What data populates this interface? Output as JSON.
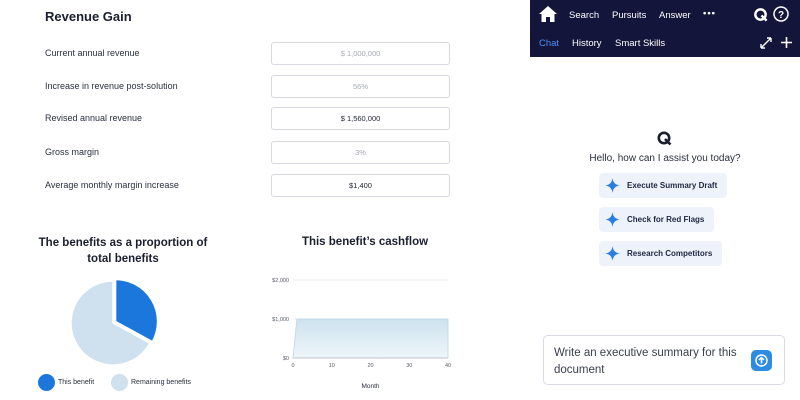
{
  "form": {
    "title": "Revenue Gain",
    "rows": [
      {
        "label": "Current annual revenue",
        "value": "$ 1,000,000",
        "placeholder": true
      },
      {
        "label": "Increase in revenue post-solution",
        "value": "56%",
        "placeholder": true
      },
      {
        "label": "Revised annual revenue",
        "value": "$ 1,560,000",
        "placeholder": false
      },
      {
        "label": "Gross margin",
        "value": "3%",
        "placeholder": true
      },
      {
        "label": "Average monthly margin increase",
        "value": "$1,400",
        "placeholder": false
      }
    ]
  },
  "pie": {
    "title_line1": "The benefits as a proportion of",
    "title_line2": "total benefits",
    "legend": [
      {
        "label": "This benefit",
        "color": "#1b77dc"
      },
      {
        "label": "Remaining benefits",
        "color": "#cfe0ee"
      }
    ]
  },
  "cashflow": {
    "title": "This benefit’s cashflow",
    "xlabel": "Month"
  },
  "chart_data": [
    {
      "type": "pie",
      "title": "The benefits as a proportion of total benefits",
      "slices": [
        {
          "label": "This benefit",
          "value": 0.33,
          "color": "#1b77dc"
        },
        {
          "label": "Remaining benefits",
          "value": 0.67,
          "color": "#cfe0ee"
        }
      ]
    },
    {
      "type": "area",
      "title": "This benefit’s cashflow",
      "xlabel": "Month",
      "ylabel": "",
      "x_ticks": [
        "0",
        "10",
        "20",
        "30",
        "40"
      ],
      "y_ticks": [
        "$0",
        "$1,000",
        "$2,000"
      ],
      "xlim": [
        0,
        40
      ],
      "ylim": [
        0,
        2000
      ],
      "grid": true,
      "series": [
        {
          "x": [
            0,
            1,
            40
          ],
          "y": [
            0,
            1000,
            1000
          ],
          "color": "#cfe3ef"
        }
      ]
    }
  ],
  "assistant": {
    "nav_top": [
      "Search",
      "Pursuits",
      "Answer",
      "•••"
    ],
    "nav_tabs": [
      "Chat",
      "History",
      "Smart Skills"
    ],
    "greeting": "Hello, how can I assist you today?",
    "suggestions": [
      "Execute Summary Draft",
      "Check for Red Flags",
      "Research Competitors"
    ],
    "input_value": "Write an executive summary for this document"
  },
  "colors": {
    "topbar": "#13153a",
    "accent": "#4c8ff5",
    "spark": "#2a7de1"
  }
}
